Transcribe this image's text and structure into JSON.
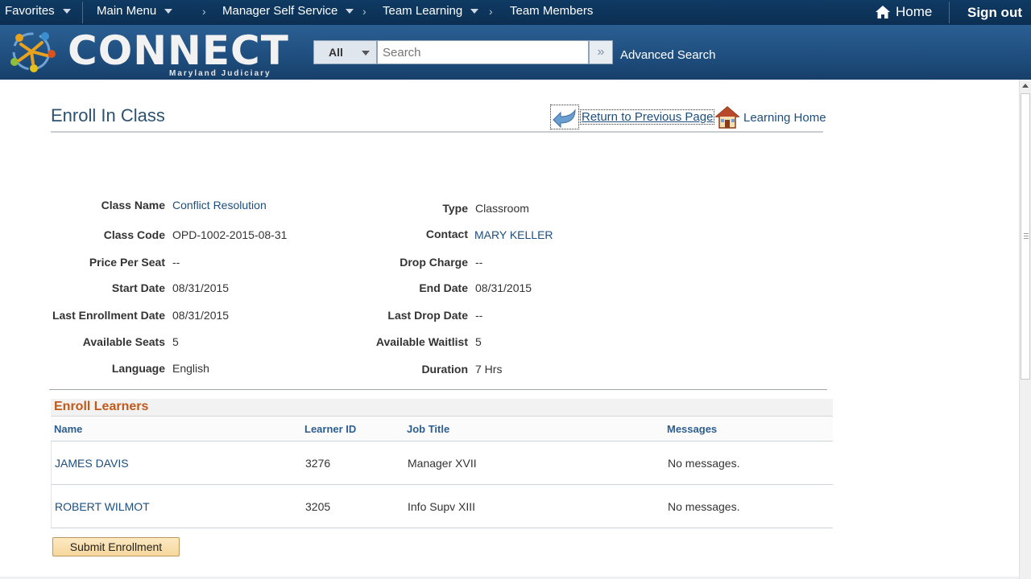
{
  "topnav": {
    "favorites": "Favorites",
    "main_menu": "Main Menu",
    "breadcrumbs": [
      "Manager Self Service",
      "Team Learning",
      "Team Members"
    ],
    "home": "Home",
    "sign_out": "Sign out"
  },
  "banner": {
    "logo_text": "CONNECT",
    "logo_subtitle": "Maryland Judiciary",
    "search_scope": "All",
    "search_placeholder": "Search",
    "advanced_search": "Advanced Search"
  },
  "page": {
    "title": "Enroll In Class",
    "return_link": "Return to Previous Page",
    "learning_home": "Learning Home"
  },
  "details": {
    "class_name_label": "Class Name",
    "class_name": "Conflict Resolution",
    "type_label": "Type",
    "type": "Classroom",
    "class_code_label": "Class Code",
    "class_code": "OPD-1002-2015-08-31",
    "contact_label": "Contact",
    "contact": "MARY KELLER",
    "price_label": "Price Per Seat",
    "price": "--",
    "drop_charge_label": "Drop Charge",
    "drop_charge": "--",
    "start_date_label": "Start Date",
    "start_date": "08/31/2015",
    "end_date_label": "End Date",
    "end_date": "08/31/2015",
    "last_enroll_label": "Last Enrollment Date",
    "last_enroll": "08/31/2015",
    "last_drop_label": "Last Drop Date",
    "last_drop": "--",
    "seats_label": "Available Seats",
    "seats": "5",
    "waitlist_label": "Available Waitlist",
    "waitlist": "5",
    "language_label": "Language",
    "language": "English",
    "duration_label": "Duration",
    "duration": "7 Hrs"
  },
  "enroll_grid": {
    "title": "Enroll Learners",
    "columns": [
      "Name",
      "Learner ID",
      "Job Title",
      "Messages"
    ],
    "rows": [
      {
        "name": "JAMES DAVIS",
        "learner_id": "3276",
        "job_title": "Manager XVII",
        "messages": "No messages."
      },
      {
        "name": "ROBERT WILMOT",
        "learner_id": "3205",
        "job_title": "Info Supv XIII",
        "messages": "No messages."
      }
    ]
  },
  "submit_label": "Submit Enrollment",
  "colors": {
    "nav_bg": "#0f3a63",
    "banner_bg": "#1f4f80",
    "link": "#1d4e7e",
    "grid_title": "#c05a1a",
    "button_bg": "#f6d79d"
  }
}
